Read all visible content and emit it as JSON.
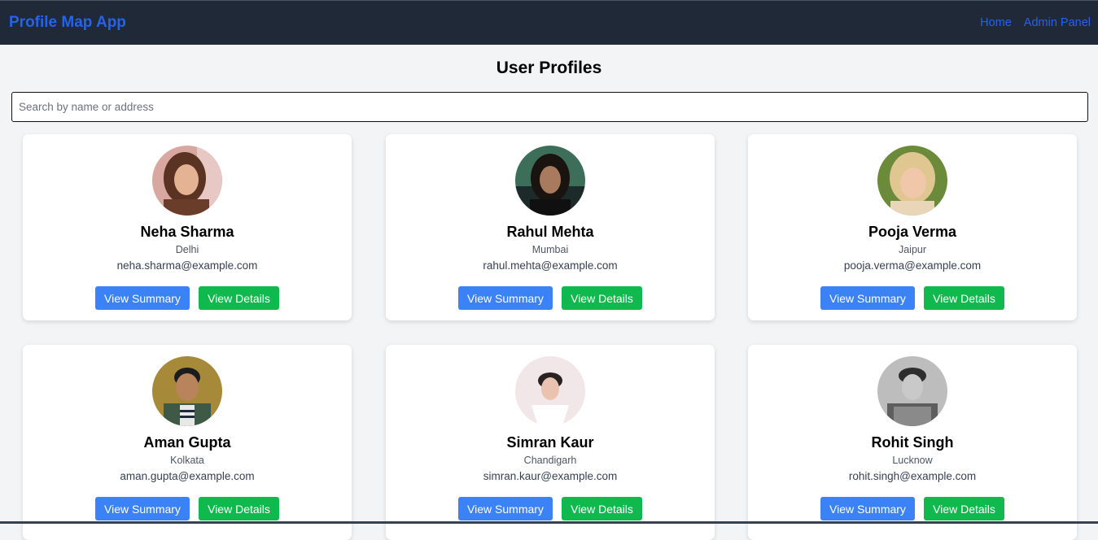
{
  "app": {
    "brand": "Profile Map App",
    "nav": [
      {
        "label": "Home"
      },
      {
        "label": "Admin Panel"
      }
    ]
  },
  "page": {
    "title": "User Profiles"
  },
  "search": {
    "placeholder": "Search by name or address",
    "value": ""
  },
  "buttons": {
    "summary": "View Summary",
    "details": "View Details"
  },
  "profiles": [
    {
      "name": "Neha Sharma",
      "city": "Delhi",
      "email": "neha.sharma@example.com"
    },
    {
      "name": "Rahul Mehta",
      "city": "Mumbai",
      "email": "rahul.mehta@example.com"
    },
    {
      "name": "Pooja Verma",
      "city": "Jaipur",
      "email": "pooja.verma@example.com"
    },
    {
      "name": "Aman Gupta",
      "city": "Kolkata",
      "email": "aman.gupta@example.com"
    },
    {
      "name": "Simran Kaur",
      "city": "Chandigarh",
      "email": "simran.kaur@example.com"
    },
    {
      "name": "Rohit Singh",
      "city": "Lucknow",
      "email": "rohit.singh@example.com"
    }
  ],
  "colors": {
    "navbar": "#1f2937",
    "brand": "#2563eb",
    "summary_button": "#3b82f6",
    "details_button": "#10b94d"
  }
}
